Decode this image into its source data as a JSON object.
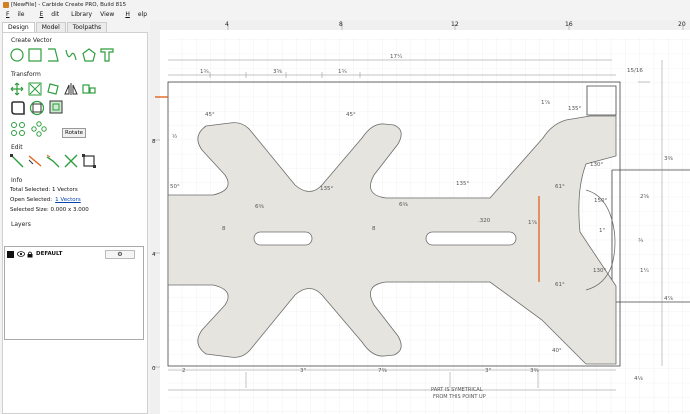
{
  "window": {
    "title": "[NewFile] - Carbide Create PRO, Build 815"
  },
  "menu": {
    "file_f": "F",
    "file_rest": "ile",
    "edit_e": "E",
    "edit_rest": "dit",
    "library": "Library",
    "view": "View",
    "help_h": "H",
    "help_rest": "elp"
  },
  "tabs": {
    "design": "Design",
    "model": "Model",
    "toolpaths": "Toolpaths"
  },
  "sections": {
    "create_vector": "Create Vector",
    "transform": "Transform",
    "edit": "Edit",
    "info": "Info",
    "layers": "Layers"
  },
  "tooltip": "Rotate",
  "info": {
    "total_selected_label": "Total Selected:",
    "total_selected_value": "1 Vectors",
    "open_selected_label": "Open Selected:",
    "open_selected_value": "1 Vectors",
    "selected_size_label": "Selected Size:",
    "selected_size_value": "0.000 x 3.000"
  },
  "layers": {
    "default_name": "DEFAULT",
    "gear": "⚙"
  },
  "colors": {
    "accent_green": "#2e9e3e",
    "selection_orange": "#e2631f",
    "part_fill": "#e6e4df"
  },
  "ruler": {
    "top": [
      "4",
      "8",
      "12",
      "16",
      "20"
    ],
    "left": [
      "8",
      "4",
      "0"
    ]
  },
  "dimensions": {
    "top_overall": "17¼",
    "top_right": "15/16",
    "top_a": "1¾",
    "top_b": "3⅝",
    "top_c": "1¾",
    "left_a": "½",
    "right_a": "3⅜",
    "right_b": "2⅝",
    "right_c": "4⅞",
    "bottom_a": "2",
    "bottom_b": "3\"",
    "bottom_c": "7⅜",
    "bottom_d": "3\"",
    "bottom_e": "3⅜",
    "bottom_right": "4⅛",
    "note_1": "PART IS SYMETRICAL",
    "note_2": "FROM THIS POINT UP",
    "ang_45a": "45°",
    "ang_45b": "45°",
    "ang_135a": "135°",
    "ang_135b": "135°",
    "ang_135c": "135°",
    "ang_50": "50°",
    "ang_61a": "61°",
    "ang_61b": "61°",
    "ang_40": "40°",
    "ang_150": "150°",
    "ang_130a": "130°",
    "ang_130b": "130°",
    "r_320": ".320",
    "d_1": "1\"",
    "d_6a": "6⅜",
    "d_6b": "6⅜",
    "d_8a": "8",
    "d_8b": "8",
    "d_1_8": "1⅞",
    "d_1_8b": "1⅞",
    "d_3_4": "¾",
    "d_1_4": "1¼"
  }
}
